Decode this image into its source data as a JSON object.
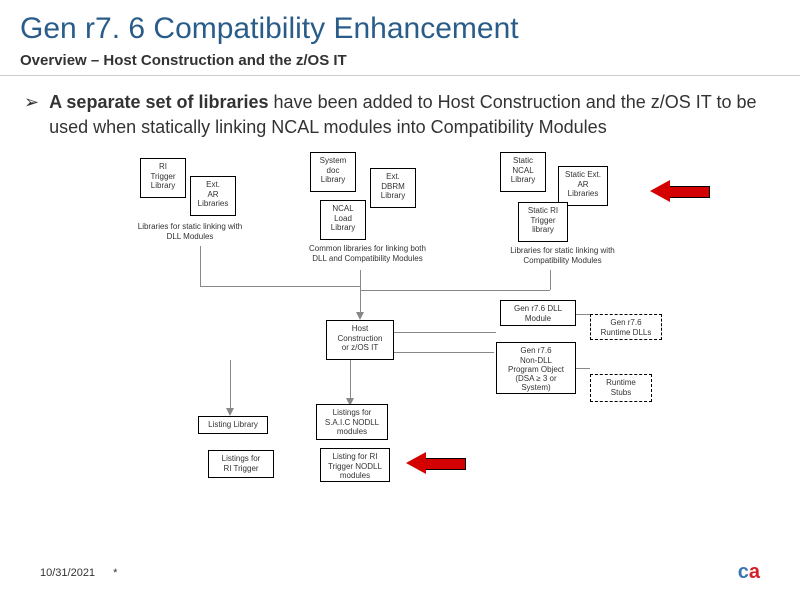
{
  "title": "Gen r7. 6 Compatibility Enhancement",
  "subtitle": "Overview – Host Construction and the z/OS IT",
  "bullet": {
    "mark": "➢",
    "bold": "A separate set of libraries",
    "rest": " have been added to Host Construction and the z/OS IT to be used when statically linking NCAL modules into Compatibility Modules"
  },
  "boxes": {
    "ri_trigger": "RI\nTrigger\nLibrary",
    "ext_ar": "Ext.\nAR\nLibraries",
    "system_doc": "System\ndoc\nLibrary",
    "ext_dbrm": "Ext.\nDBRM\nLibrary",
    "ncal_load": "NCAL\nLoad\nLibrary",
    "static_ncal": "Static\nNCAL\nLibrary",
    "static_ext_ar": "Static Ext.\nAR\nLibraries",
    "static_ri_trigger": "Static RI\nTrigger\nlibrary",
    "host_constr": "Host\nConstruction\nor z/OS IT",
    "gen76_dll": "Gen r7.6 DLL\nModule",
    "gen76_runtime": "Gen r7.6\nRuntime DLLs",
    "gen76_nondll": "Gen r7.6\nNon-DLL\nProgram Object\n(DSA ≥ 3 or\nSystem)",
    "runtime_stubs": "Runtime\nStubs",
    "listing": "Listing Library",
    "listings_saic": "Listings for\nS.A.I.C NODLL\nmodules",
    "listing_ri_trigger": "Listings for\nRI Trigger",
    "listing_ri_nodll": "Listing for RI\nTrigger NODLL\nmodules"
  },
  "captions": {
    "left_group": "Libraries for static linking with\nDLL Modules",
    "mid_group": "Common libraries for linking both\nDLL and Compatibility Modules",
    "right_group": "Libraries for static linking with\nCompatibility Modules"
  },
  "footer": {
    "date": "10/31/2021",
    "marker": "*",
    "logo_c": "c",
    "logo_a": "a"
  }
}
